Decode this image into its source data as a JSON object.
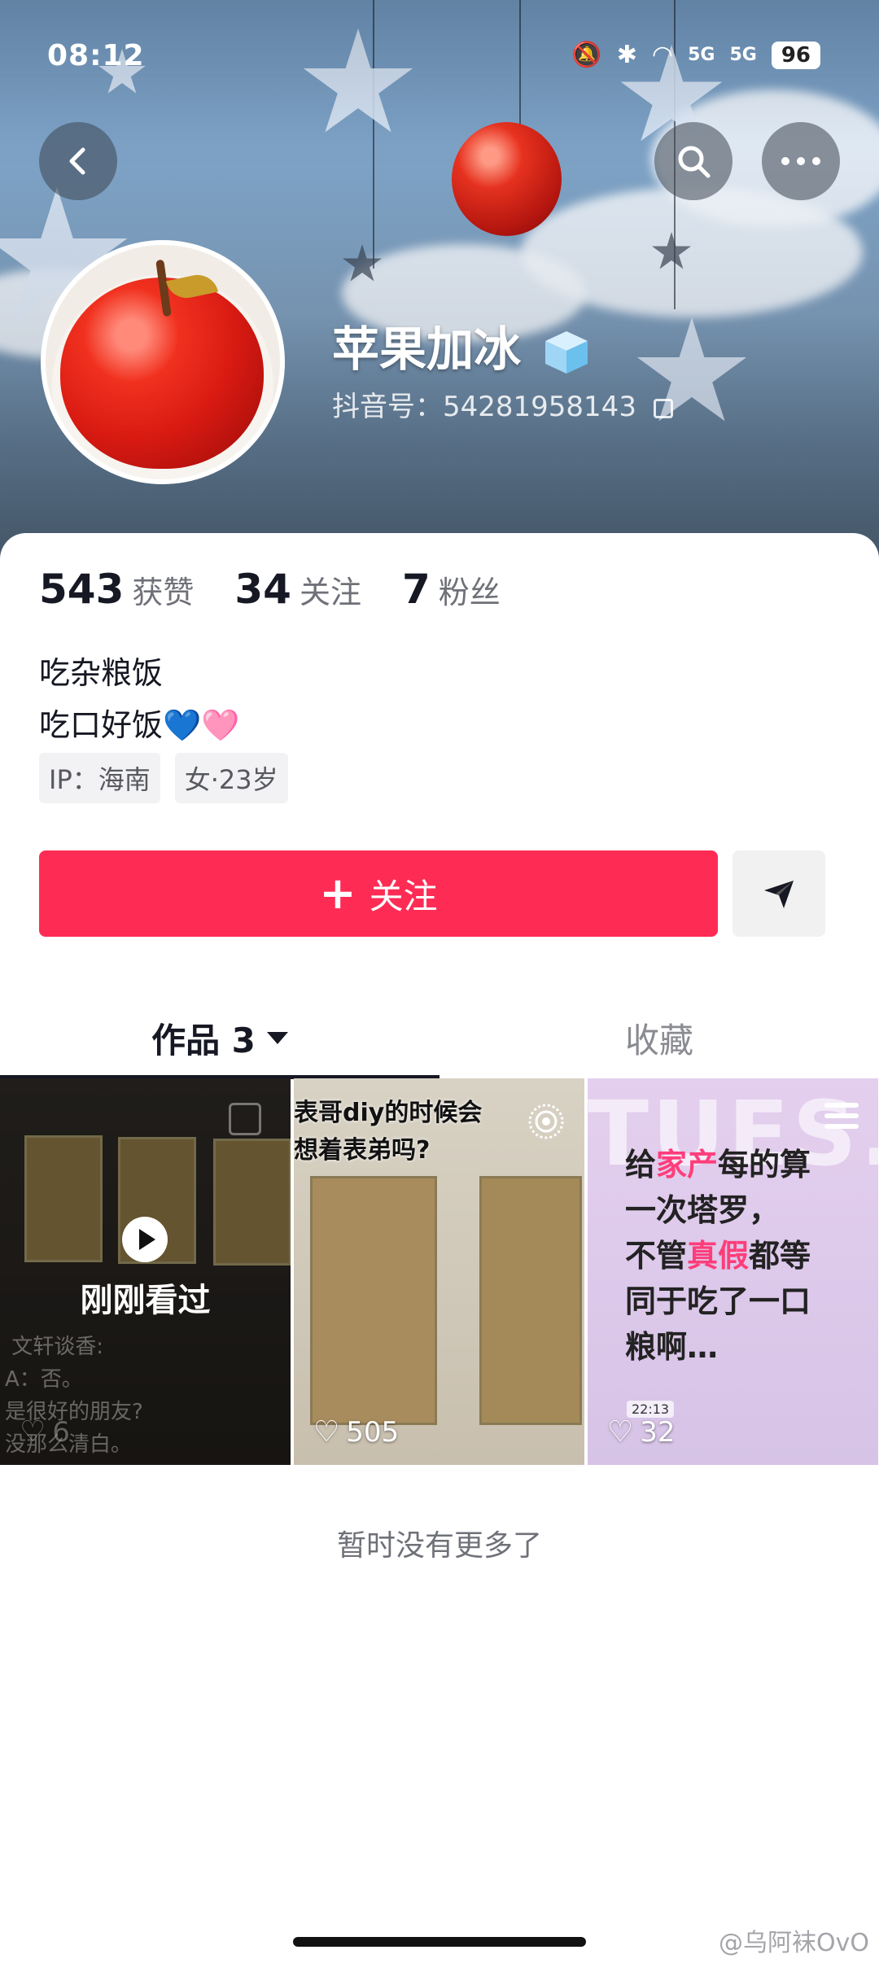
{
  "status_bar": {
    "time": "08:12",
    "signal_1": "5G",
    "signal_2": "5G",
    "battery": "96"
  },
  "profile": {
    "username": "苹果加冰",
    "douyin_id": "抖音号：54281958143",
    "stats": [
      {
        "value": "543",
        "label": "获赞"
      },
      {
        "value": "34",
        "label": "关注"
      },
      {
        "value": "7",
        "label": "粉丝"
      }
    ],
    "bio_line_1": "吃杂粮饭",
    "bio_line_2": "吃口好饭",
    "bio_emoji_1": "💙",
    "bio_emoji_2": "🩷",
    "tags": [
      "IP：海南",
      "女·23岁"
    ]
  },
  "actions": {
    "follow_plus": "+",
    "follow_label": "关注"
  },
  "tabs": {
    "works_label": "作品 3",
    "favorites_label": "收藏"
  },
  "videos": [
    {
      "overlay": "刚刚看过",
      "bg_text": " 文轩谈香:\nA：否。\n是很好的朋友?\n没那么清白。",
      "likes": "6"
    },
    {
      "caption": "表哥diy的时候会\n想着表弟吗?",
      "likes": "505"
    },
    {
      "bg_text": "TUES.",
      "text_pre": "给",
      "text_hl_1": "家产",
      "text_mid": "每的算\n一次塔罗，\n不管",
      "text_hl_2": "真假",
      "text_post": "都等\n同于吃了一口\n粮啊…",
      "time_badge": "22:13",
      "likes": "32"
    }
  ],
  "footer": {
    "no_more": "暂时没有更多了",
    "watermark": "@乌阿袜OvO"
  },
  "colors": {
    "follow_button": "#fe2c55",
    "highlight": "#ff3d7a"
  }
}
